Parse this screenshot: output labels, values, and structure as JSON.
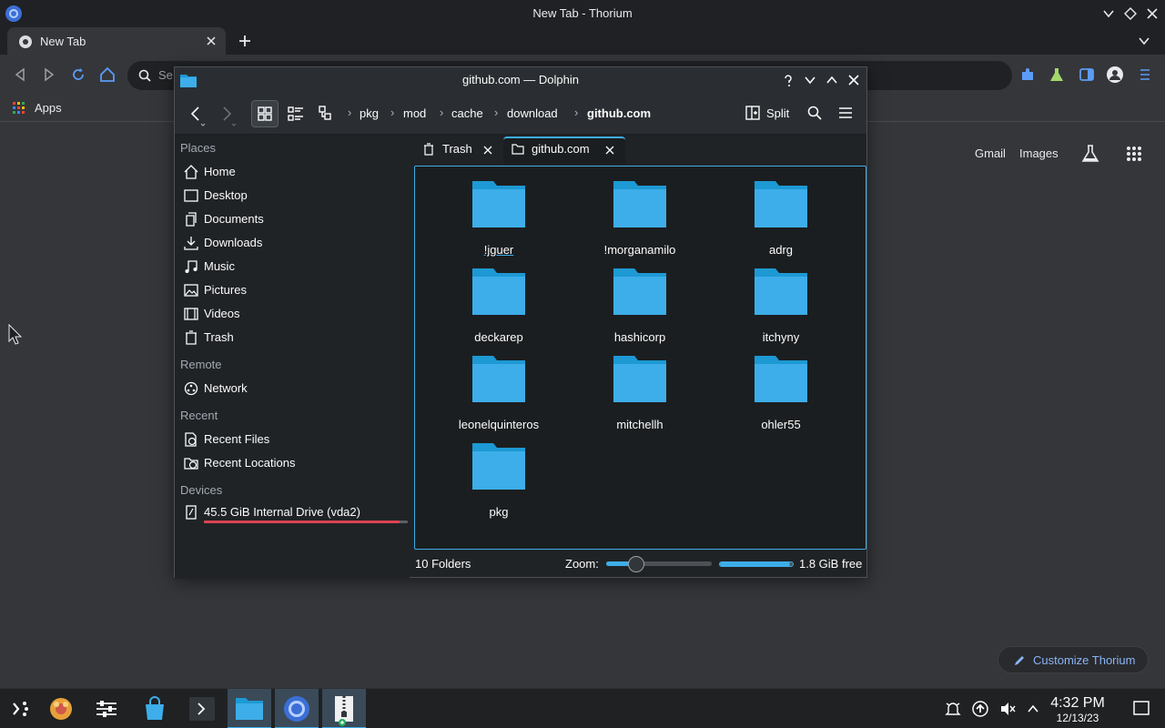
{
  "browser": {
    "window_title": "New Tab - Thorium",
    "tab_title": "New Tab",
    "omnibox_placeholder": "Se",
    "bookmarks_apps": "Apps"
  },
  "ntp": {
    "gmail": "Gmail",
    "images": "Images",
    "customize": "Customize Thorium"
  },
  "dolphin": {
    "title": "github.com — Dolphin",
    "breadcrumb": [
      "pkg",
      "mod",
      "cache",
      "download",
      "github.com"
    ],
    "split_label": "Split",
    "places": {
      "sections": [
        "Places",
        "Remote",
        "Recent",
        "Devices"
      ],
      "places_items": [
        {
          "label": "Home",
          "icon": "home-icon"
        },
        {
          "label": "Desktop",
          "icon": "desktop-icon"
        },
        {
          "label": "Documents",
          "icon": "documents-icon"
        },
        {
          "label": "Downloads",
          "icon": "downloads-icon"
        },
        {
          "label": "Music",
          "icon": "music-icon"
        },
        {
          "label": "Pictures",
          "icon": "pictures-icon"
        },
        {
          "label": "Videos",
          "icon": "videos-icon"
        },
        {
          "label": "Trash",
          "icon": "trash-icon"
        }
      ],
      "remote_items": [
        {
          "label": "Network",
          "icon": "network-icon"
        }
      ],
      "recent_items": [
        {
          "label": "Recent Files",
          "icon": "recent-files-icon"
        },
        {
          "label": "Recent Locations",
          "icon": "recent-locations-icon"
        }
      ],
      "device_items": [
        {
          "label": "45.5 GiB Internal Drive (vda2)",
          "icon": "drive-icon"
        }
      ]
    },
    "tabs": [
      {
        "label": "Trash"
      },
      {
        "label": "github.com"
      }
    ],
    "folders": [
      "!jguer",
      "!morganamilo",
      "adrg",
      "deckarep",
      "hashicorp",
      "itchyny",
      "leonelquinteros",
      "mitchellh",
      "ohler55",
      "pkg"
    ],
    "status": {
      "count": "10 Folders",
      "zoom_label": "Zoom:",
      "free": "1.8 GiB free"
    }
  },
  "taskbar": {
    "time": "4:32 PM",
    "date": "12/13/23"
  },
  "colors": {
    "accent": "#3daee9",
    "folder": "#3daee9",
    "folder_tab": "#1d99d4"
  }
}
